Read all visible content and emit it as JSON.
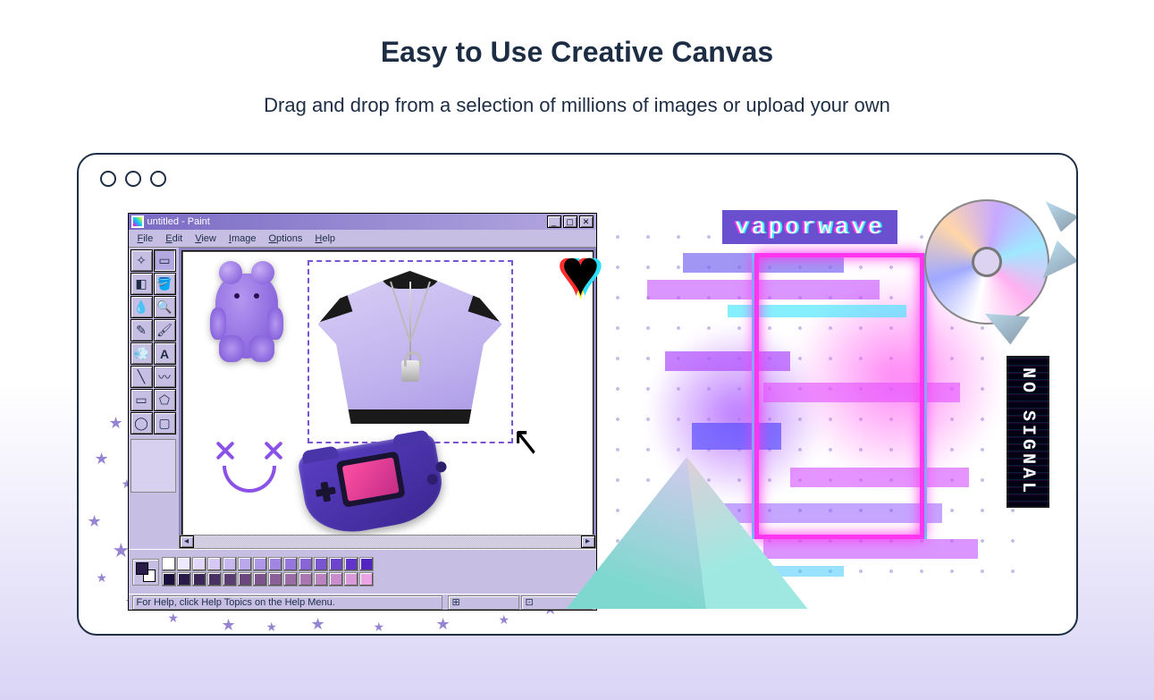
{
  "hero": {
    "title": "Easy to Use Creative Canvas",
    "subtitle": "Drag and drop from a selection of millions of images or upload your own"
  },
  "paint": {
    "title": "untitled - Paint",
    "menu": {
      "file": "File",
      "edit": "Edit",
      "view": "View",
      "image": "Image",
      "options": "Options",
      "help": "Help"
    },
    "tools": [
      "free-select",
      "rect-select",
      "eraser",
      "fill",
      "eyedropper",
      "zoom",
      "pencil",
      "brush",
      "airbrush",
      "text",
      "line",
      "curve",
      "rectangle",
      "polygon",
      "ellipse",
      "rounded-rect"
    ],
    "status": "For Help, click Help Topics on the Help Menu.",
    "palette": [
      "#ffffff",
      "#efe9ff",
      "#e2d8fa",
      "#d5c8f5",
      "#c8b8f0",
      "#bba7eb",
      "#ae97e6",
      "#a186e1",
      "#9476dc",
      "#8765d7",
      "#7a55d2",
      "#6d44cd",
      "#6034c8",
      "#5323c3",
      "#1a0f3d",
      "#2a1a4a",
      "#3a2657",
      "#4a3164",
      "#5a3d71",
      "#6a487e",
      "#7a548b",
      "#8a5f98",
      "#9a6ba5",
      "#aa76b2",
      "#ba82bf",
      "#ca8dcc",
      "#da99d9",
      "#eaa4e6"
    ]
  },
  "stickers": {
    "vaporwave_label": "vaporwave",
    "no_signal": "NO SIGNAL",
    "heart_glyph": "♥",
    "cursor_glyph": "↖"
  }
}
